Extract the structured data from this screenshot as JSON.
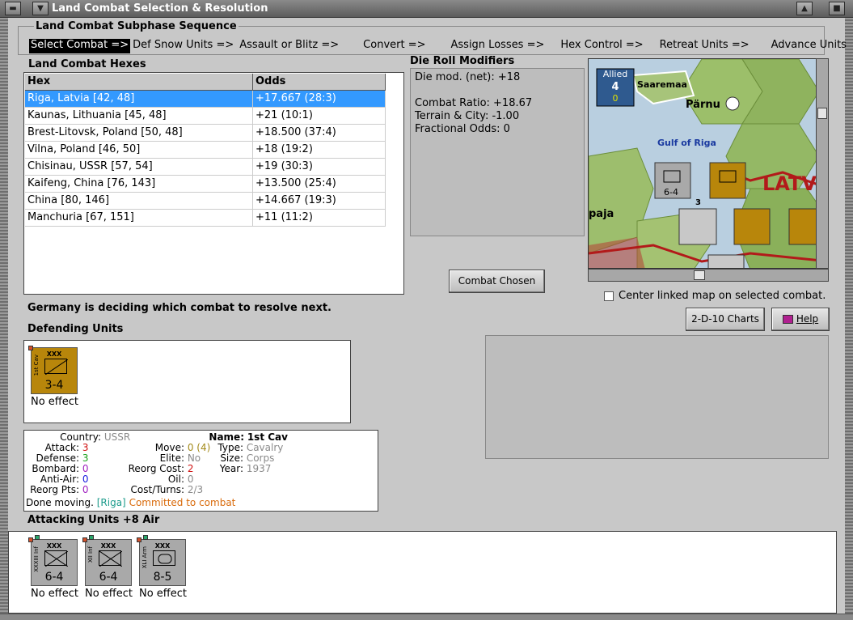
{
  "window": {
    "title": "Land Combat Selection & Resolution"
  },
  "sequence": {
    "title": "Land Combat Subphase Sequence",
    "steps": [
      {
        "label": "Select Combat =>",
        "active": true
      },
      {
        "label": "Def Snow Units =>",
        "active": false
      },
      {
        "label": "Assault or Blitz =>",
        "active": false
      },
      {
        "label": "Convert =>",
        "active": false
      },
      {
        "label": "Assign Losses =>",
        "active": false
      },
      {
        "label": "Hex Control =>",
        "active": false
      },
      {
        "label": "Retreat Units =>",
        "active": false
      },
      {
        "label": "Advance Units",
        "active": false
      }
    ]
  },
  "hexes": {
    "section_title": "Land Combat Hexes",
    "columns": [
      "Hex",
      "Odds"
    ],
    "rows": [
      {
        "hex": "Riga, Latvia [42, 48]",
        "odds": "+17.667 (28:3)",
        "selected": true
      },
      {
        "hex": "Kaunas, Lithuania [45, 48]",
        "odds": "+21 (10:1)",
        "selected": false
      },
      {
        "hex": "Brest-Litovsk, Poland [50, 48]",
        "odds": "+18.500 (37:4)",
        "selected": false
      },
      {
        "hex": "Vilna, Poland [46, 50]",
        "odds": "+18 (19:2)",
        "selected": false
      },
      {
        "hex": "Chisinau, USSR [57, 54]",
        "odds": "+19 (30:3)",
        "selected": false
      },
      {
        "hex": "Kaifeng, China [76, 143]",
        "odds": "+13.500 (25:4)",
        "selected": false
      },
      {
        "hex": "China [80, 146]",
        "odds": "+14.667 (19:3)",
        "selected": false
      },
      {
        "hex": "Manchuria [67, 151]",
        "odds": "+11 (11:2)",
        "selected": false
      }
    ]
  },
  "die_roll": {
    "title": "Die Roll Modifiers",
    "net": "Die mod. (net): +18",
    "ratio": "Combat Ratio: +18.67",
    "terrain": "Terrain & City: -1.00",
    "fractional": "Fractional Odds: 0"
  },
  "map": {
    "allied_label": "Allied",
    "allied_count": "4",
    "allied_sub": "0",
    "labels": [
      "Saaremaa",
      "Pärnu",
      "Gulf of Riga",
      "LATV",
      "paja"
    ],
    "stack_count": "3"
  },
  "buttons": {
    "combat_chosen": "Combat Chosen",
    "charts": "2-D-10 Charts",
    "help": "Help"
  },
  "center_map_label": "Center linked map on selected combat.",
  "status": "Germany is deciding which combat to resolve next.",
  "defending": {
    "title": "Defending Units",
    "units": [
      {
        "size": "XXX",
        "name": "1st Cav",
        "strength": "3-4",
        "result": "No effect",
        "color": "#b8860b"
      }
    ]
  },
  "unit_info": {
    "country_label": "Country:",
    "country": "USSR",
    "attack_label": "Attack:",
    "attack": "3",
    "defense_label": "Defense:",
    "defense": "3",
    "bombard_label": "Bombard:",
    "bombard": "0",
    "antiair_label": "Anti-Air:",
    "antiair": "0",
    "reorg_label": "Reorg Pts:",
    "reorg": "0",
    "name_label": "Name:",
    "name": "1st Cav",
    "move_label": "Move:",
    "move": "0 (4)",
    "elite_label": "Elite:",
    "elite": "No",
    "reorg_cost_label": "Reorg Cost:",
    "reorg_cost": "2",
    "oil_label": "Oil:",
    "oil": "0",
    "cost_label": "Cost/Turns:",
    "cost": "2/3",
    "type_label": "Type:",
    "type": "Cavalry",
    "size_label": "Size:",
    "size": "Corps",
    "year_label": "Year:",
    "year": "1937",
    "done_moving": "Done moving.",
    "location": "[Riga]",
    "committed": "Committed to combat"
  },
  "attacking": {
    "title": "Attacking Units +8 Air",
    "units": [
      {
        "size": "XXX",
        "name": "XXXIII Inf",
        "strength": "6-4",
        "result": "No effect"
      },
      {
        "size": "XXX",
        "name": "XII Inf",
        "strength": "6-4",
        "result": "No effect"
      },
      {
        "size": "XXX",
        "name": "XLI Arm",
        "strength": "8-5",
        "result": "No effect"
      }
    ]
  },
  "colors": {
    "selected_row": "#3399ff",
    "soviet_counter": "#b8860b",
    "german_counter": "#a9a9a9"
  }
}
